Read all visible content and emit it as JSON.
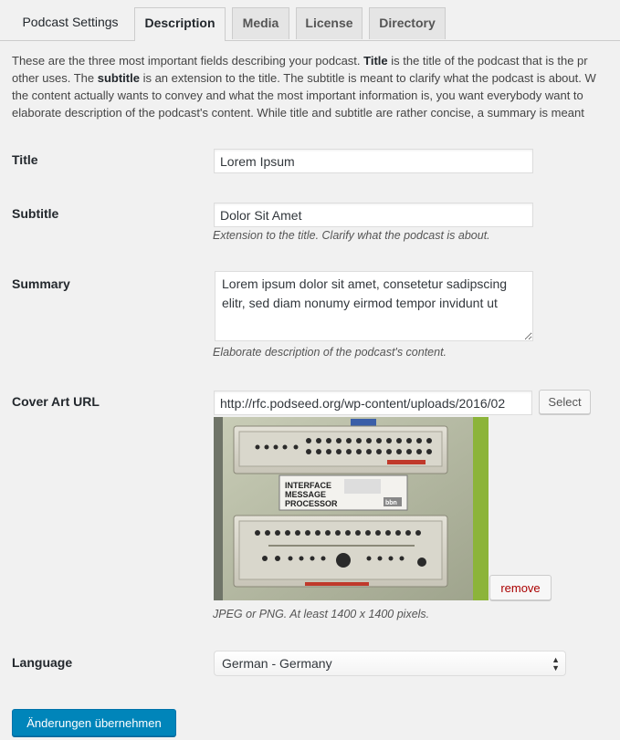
{
  "tabs": [
    {
      "label": "Podcast Settings"
    },
    {
      "label": "Description"
    },
    {
      "label": "Media"
    },
    {
      "label": "License"
    },
    {
      "label": "Directory"
    }
  ],
  "intro": {
    "line1_a": "These are the three most important fields describing your podcast. ",
    "line1_b": "Title",
    "line1_c": " is the title of the podcast that is the pr",
    "line2_a": "other uses. The ",
    "line2_b": "subtitle",
    "line2_c": " is an extension to the title. The subtitle is meant to clarify what the podcast is about. W",
    "line3": "the content actually wants to convey and what the most important information is, you want everybody want to",
    "line4": "elaborate description of the podcast's content. While title and subtitle are rather concise, a summary is meant"
  },
  "fields": {
    "title": {
      "label": "Title",
      "value": "Lorem Ipsum"
    },
    "subtitle": {
      "label": "Subtitle",
      "value": "Dolor Sit Amet",
      "description": "Extension to the title. Clarify what the podcast is about."
    },
    "summary": {
      "label": "Summary",
      "value": "Lorem ipsum dolor sit amet, consetetur sadipscing elitr, sed diam nonumy eirmod tempor invidunt ut",
      "description": "Elaborate description of the podcast's content."
    },
    "cover": {
      "label": "Cover Art URL",
      "value": "http://rfc.podseed.org/wp-content/uploads/2016/02",
      "select_label": "Select",
      "remove_label": "remove",
      "description": "JPEG or PNG. At least 1400 x 1400 pixels.",
      "image_text": {
        "line1": "INTERFACE",
        "line2": "MESSAGE",
        "line3": "PROCESSOR",
        "brand": "bbn"
      }
    },
    "language": {
      "label": "Language",
      "value": "German - Germany"
    }
  },
  "submit_label": "Änderungen übernehmen",
  "colors": {
    "primary": "#0085ba",
    "remove": "#aa0000",
    "background": "#f1f1f1"
  }
}
